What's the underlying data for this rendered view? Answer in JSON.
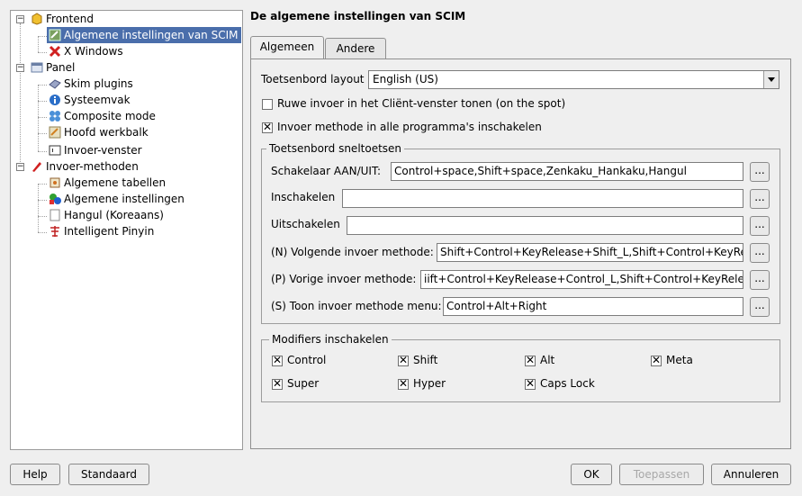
{
  "tree": {
    "frontend": "Frontend",
    "scim_general": "Algemene instellingen van SCIM",
    "xwindows": "X Windows",
    "panel": "Panel",
    "skim_plugins": "Skim plugins",
    "systray": "Systeemvak",
    "composite": "Composite mode",
    "main_toolbar": "Hoofd werkbalk",
    "input_window": "Invoer-venster",
    "input_methods": "Invoer-methoden",
    "general_tables": "Algemene tabellen",
    "general_settings": "Algemene instellingen",
    "hangul": "Hangul (Koreaans)",
    "pinyin": "Intelligent Pinyin"
  },
  "heading": "De algemene instellingen van SCIM",
  "tabs": [
    "Algemeen",
    "Andere"
  ],
  "keyboard_layout": {
    "label": "Toetsenbord layout",
    "value": "English (US)"
  },
  "checkboxes": {
    "onthespot": {
      "label": "Ruwe invoer in het Cliënt-venster tonen (on the spot)",
      "checked": false
    },
    "all_programs": {
      "label": "Invoer methode in alle programma's inschakelen",
      "checked": true
    }
  },
  "hotkeys": {
    "title": "Toetsenbord sneltoetsen",
    "rows": [
      {
        "label": "Schakelaar AAN/UIT:",
        "value": "Control+space,Shift+space,Zenkaku_Hankaku,Hangul"
      },
      {
        "label": "Inschakelen",
        "value": ""
      },
      {
        "label": "Uitschakelen",
        "value": ""
      },
      {
        "label": "(N) Volgende invoer methode:",
        "value": "Shift+Control+KeyRelease+Shift_L,Shift+Control+KeyRel"
      },
      {
        "label": "(P) Vorige invoer methode:",
        "value": "iift+Control+KeyRelease+Control_L,Shift+Control+KeyRelea"
      },
      {
        "label": "(S) Toon invoer methode menu:",
        "value": "Control+Alt+Right"
      }
    ],
    "browse": "..."
  },
  "modifiers": {
    "title": "Modifiers inschakelen",
    "items": [
      {
        "label": "Control",
        "checked": true
      },
      {
        "label": "Shift",
        "checked": true
      },
      {
        "label": "Alt",
        "checked": true
      },
      {
        "label": "Meta",
        "checked": true
      },
      {
        "label": "Super",
        "checked": true
      },
      {
        "label": "Hyper",
        "checked": true
      },
      {
        "label": "Caps Lock",
        "checked": true
      }
    ]
  },
  "buttons": {
    "help": "Help",
    "defaults": "Standaard",
    "ok": "OK",
    "apply": "Toepassen",
    "cancel": "Annuleren"
  },
  "check_mark": "✕",
  "colors": {
    "selection": "#4a6eab"
  }
}
